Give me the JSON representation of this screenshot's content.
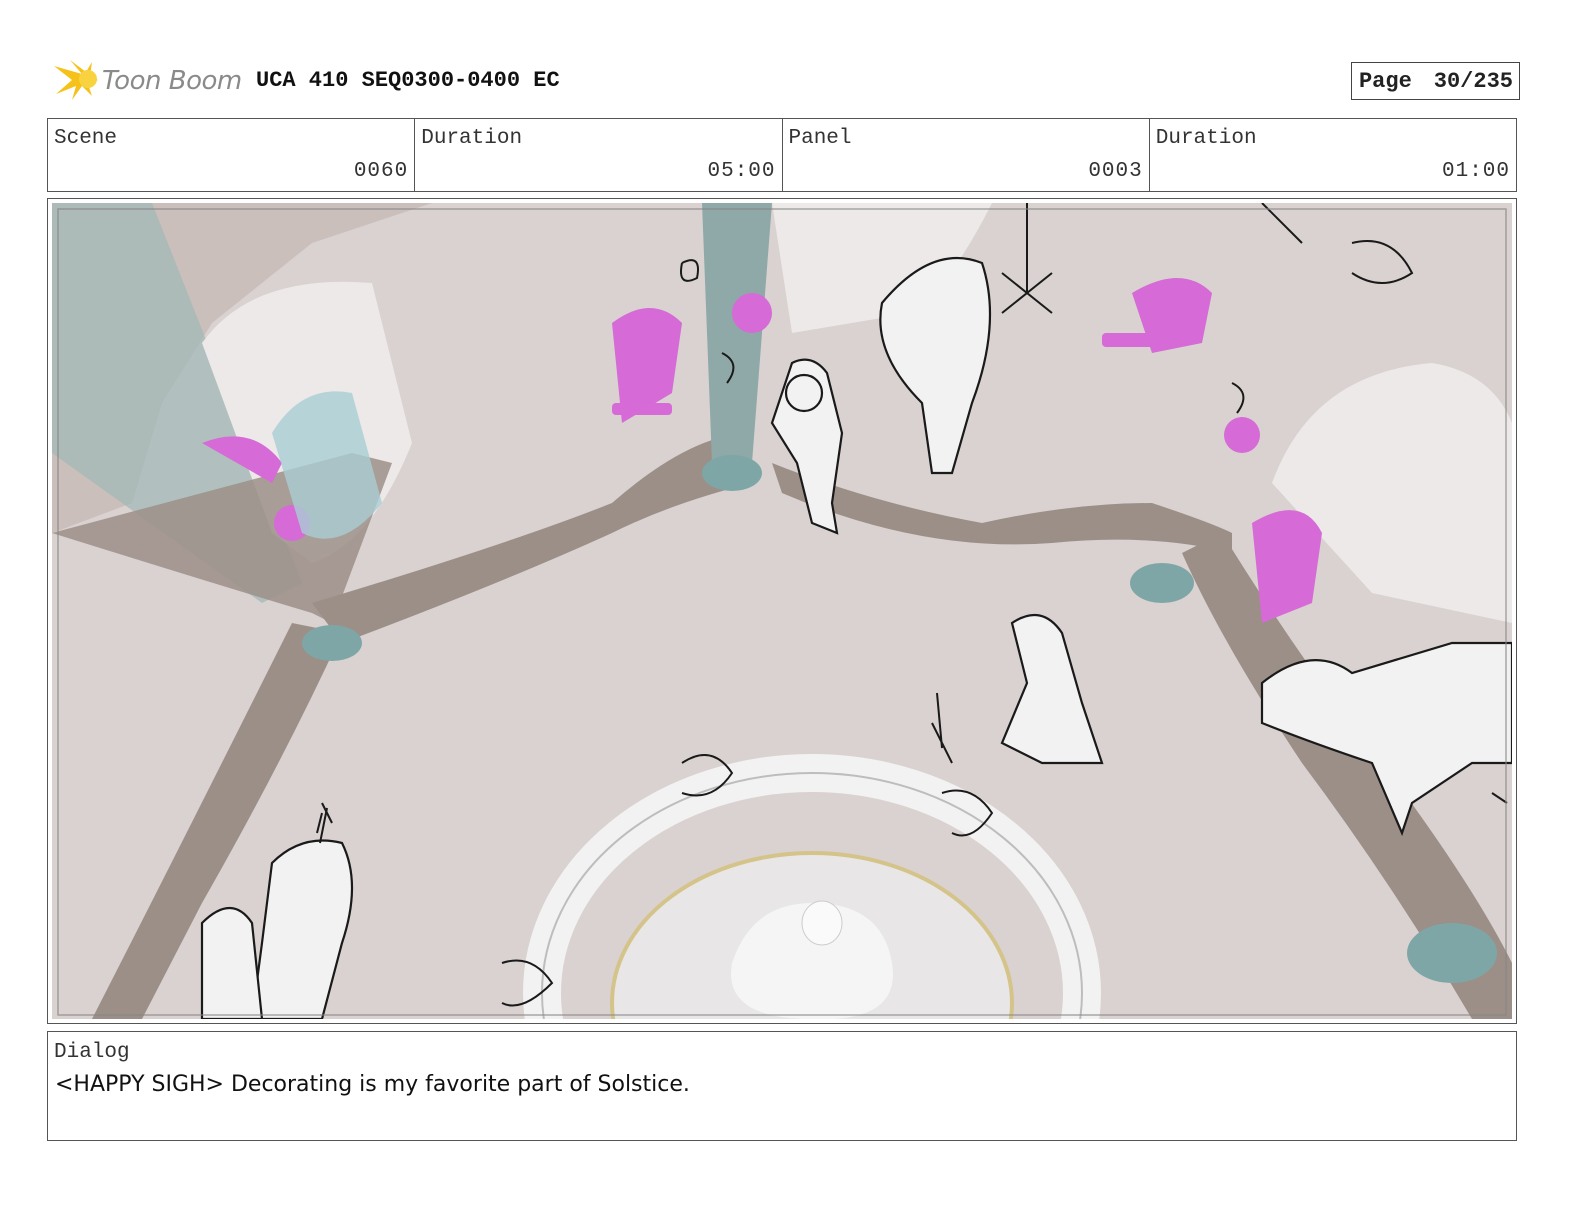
{
  "header": {
    "logo_text": "Toon Boom",
    "doc_title": "UCA 410 SEQ0300-0400 EC",
    "page_label": "Page",
    "page_number": "30/235"
  },
  "info": {
    "scene_label": "Scene",
    "scene_value": "0060",
    "scene_duration_label": "Duration",
    "scene_duration_value": "05:00",
    "panel_label": "Panel",
    "panel_value": "0003",
    "panel_duration_label": "Duration",
    "panel_duration_value": "01:00"
  },
  "dialog": {
    "label": "Dialog",
    "text": "<HAPPY SIGH> Decorating is my favorite part of Solstice."
  },
  "colors": {
    "floor": "#d9d2d0",
    "beam": "#9c8f88",
    "teal": "#7fa6a6",
    "magenta": "#d66ad6",
    "sketch": "#1a1a1a",
    "logo_yellow": "#f6c21a"
  },
  "icons": {
    "logo": "toon-boom-star-logo-icon"
  }
}
